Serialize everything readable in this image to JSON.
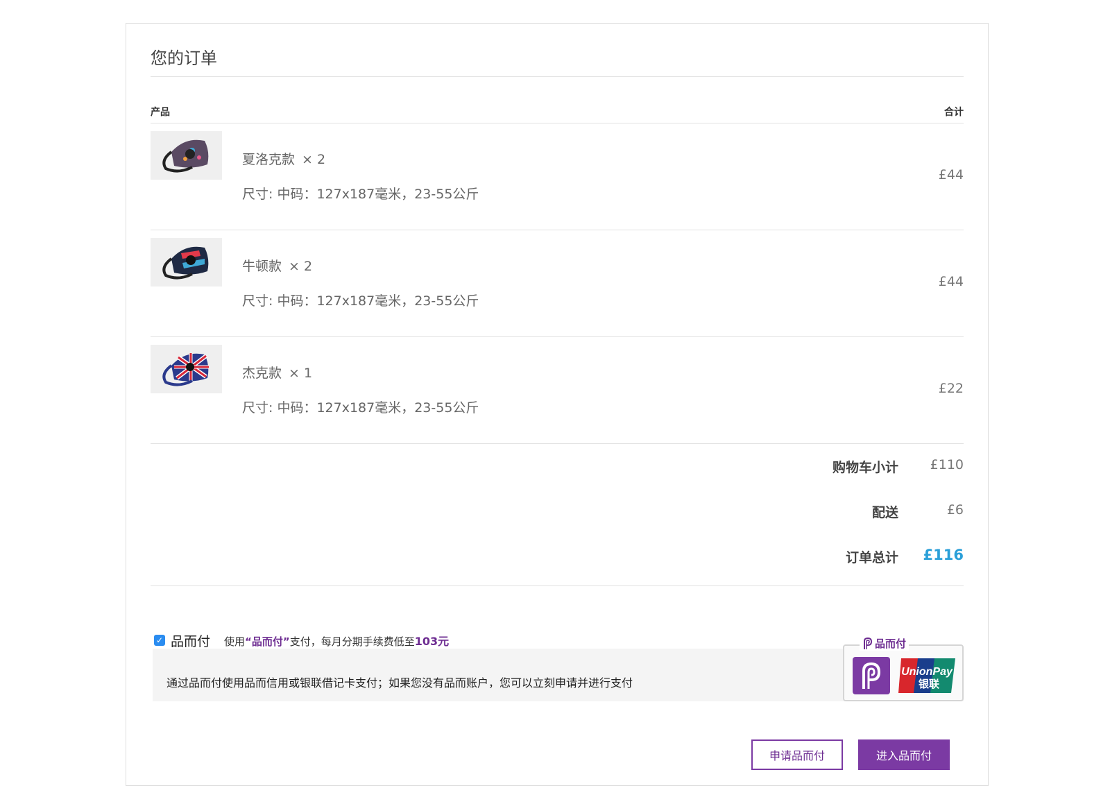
{
  "order": {
    "title": "您的订单",
    "col_product": "产品",
    "col_total": "合计",
    "items": [
      {
        "name": "夏洛克款",
        "qty": "× 2",
        "size": "尺寸: 中码：127x187毫米，23-55公斤",
        "price": "£44"
      },
      {
        "name": "牛顿款",
        "qty": "× 2",
        "size": "尺寸: 中码：127x187毫米，23-55公斤",
        "price": "£44"
      },
      {
        "name": "杰克款",
        "qty": "× 1",
        "size": "尺寸: 中码：127x187毫米，23-55公斤",
        "price": "£22"
      }
    ],
    "summary": {
      "subtotal_label": "购物车小计",
      "subtotal_value": "£110",
      "shipping_label": "配送",
      "shipping_value": "£6",
      "total_label": "订单总计",
      "total_value": "£116"
    }
  },
  "payment": {
    "checked": true,
    "check_mark": "✓",
    "name": "品而付",
    "note_prefix": "使用",
    "note_highlight": "“品而付”",
    "note_middle": "支付，每月分期手续费低至",
    "note_amount": "103元",
    "description": "通过品而付使用品而信用或银联借记卡支付；如果您没有品而账户，您可以立刻申请并进行支付",
    "logo_tag": "品而付",
    "unionpay_line1": "UnionPay",
    "unionpay_line2": "银联"
  },
  "buttons": {
    "apply": "申请品而付",
    "proceed": "进入品而付"
  },
  "colors": {
    "accent_purple": "#7b3aa3",
    "total_blue": "#2a9fd8",
    "checkbox_blue": "#2a8cf0"
  }
}
